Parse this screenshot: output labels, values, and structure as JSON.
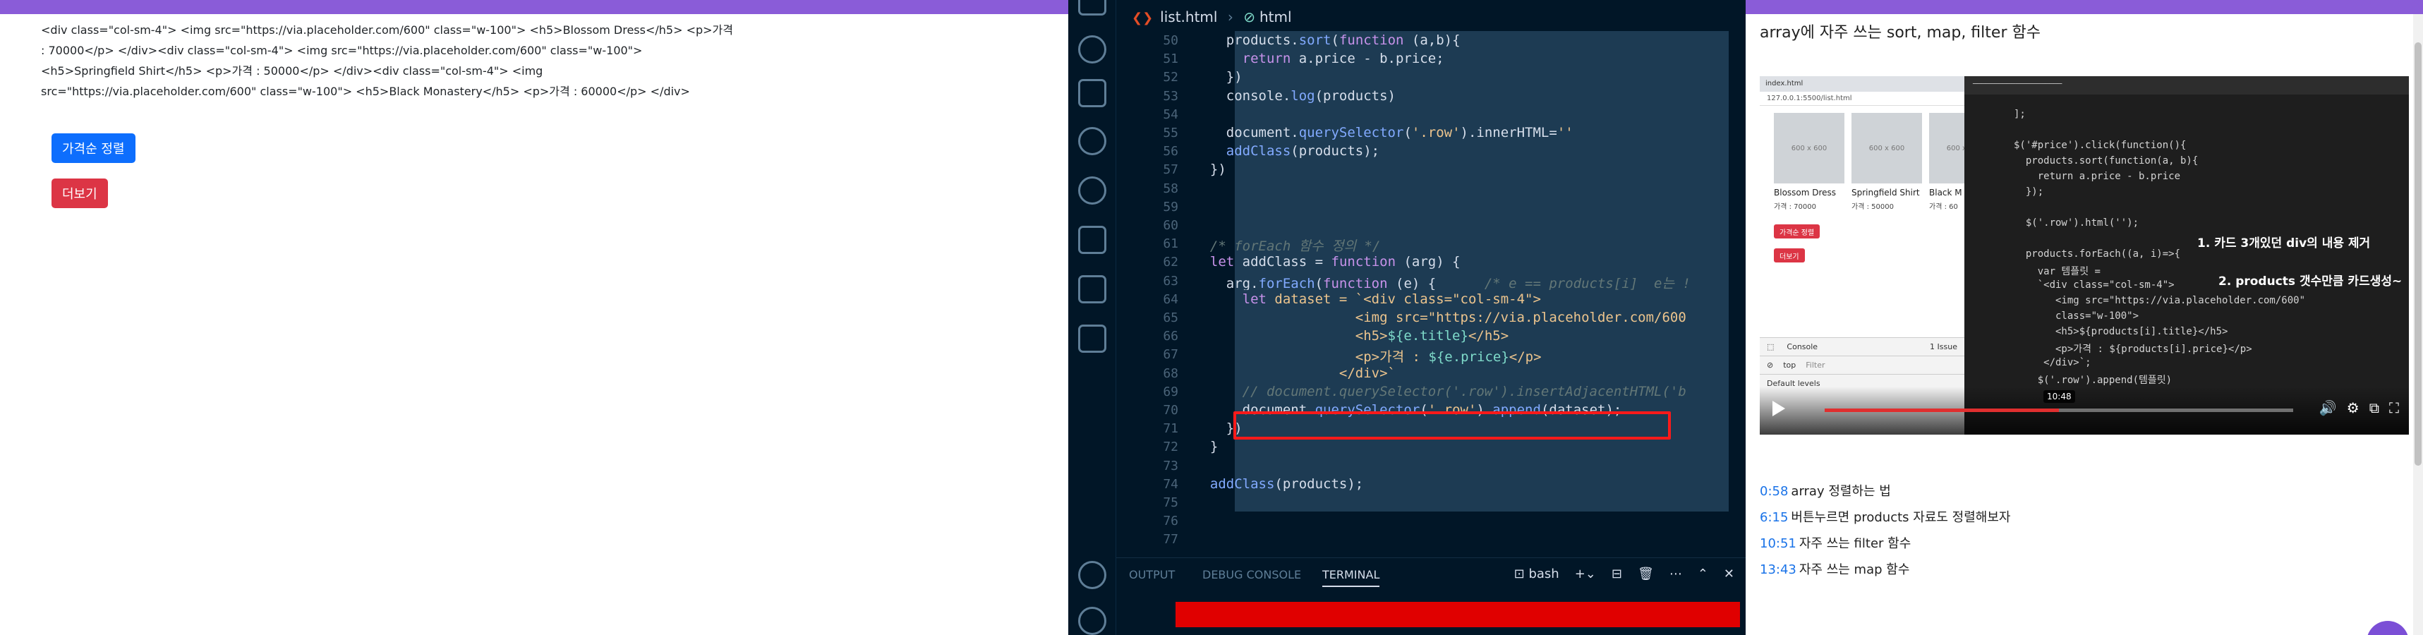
{
  "browser": {
    "raw_html_text": "<div class=\"col-sm-4\"> <img src=\"https://via.placeholder.com/600\" class=\"w-100\"> <h5>Blossom Dress</h5> <p>가격 : 70000</p> </div><div class=\"col-sm-4\"> <img src=\"https://via.placeholder.com/600\" class=\"w-100\"> <h5>Springfield Shirt</h5> <p>가격 : 50000</p> </div><div class=\"col-sm-4\"> <img src=\"https://via.placeholder.com/600\" class=\"w-100\"> <h5>Black Monastery</h5> <p>가격 : 60000</p> </div>",
    "sort_button": "가격순 정렬",
    "more_button": "더보기"
  },
  "editor": {
    "breadcrumb_file": "list.html",
    "breadcrumb_symbol": "html",
    "lines": [
      {
        "n": "50",
        "tokens": [
          [
            "    products.",
            ""
          ],
          [
            "sort",
            "f"
          ],
          [
            "(",
            ""
          ],
          [
            "function",
            "k"
          ],
          [
            " (a,b){",
            ""
          ]
        ]
      },
      {
        "n": "51",
        "tokens": [
          [
            "      ",
            ""
          ],
          [
            "return",
            "k"
          ],
          [
            " a.price - b.price;",
            ""
          ]
        ]
      },
      {
        "n": "52",
        "tokens": [
          [
            "    })",
            ""
          ]
        ]
      },
      {
        "n": "53",
        "tokens": [
          [
            "    console.",
            ""
          ],
          [
            "log",
            "f"
          ],
          [
            "(products)",
            ""
          ]
        ]
      },
      {
        "n": "54",
        "tokens": [
          [
            "",
            ""
          ]
        ]
      },
      {
        "n": "55",
        "tokens": [
          [
            "    document.",
            ""
          ],
          [
            "querySelector",
            "f"
          ],
          [
            "(",
            ""
          ],
          [
            "'.row'",
            "s"
          ],
          [
            ").innerHTML=",
            ""
          ],
          [
            "''",
            "s"
          ]
        ]
      },
      {
        "n": "56",
        "tokens": [
          [
            "    ",
            ""
          ],
          [
            "addClass",
            "f"
          ],
          [
            "(products);",
            ""
          ]
        ]
      },
      {
        "n": "57",
        "tokens": [
          [
            "  })",
            ""
          ]
        ]
      },
      {
        "n": "58",
        "tokens": [
          [
            "",
            ""
          ]
        ]
      },
      {
        "n": "59",
        "tokens": [
          [
            "",
            ""
          ]
        ]
      },
      {
        "n": "60",
        "tokens": [
          [
            "",
            ""
          ]
        ]
      },
      {
        "n": "61",
        "tokens": [
          [
            "  /* forEach 함수 정의 */",
            "c"
          ]
        ]
      },
      {
        "n": "62",
        "tokens": [
          [
            "  ",
            ""
          ],
          [
            "let",
            "k"
          ],
          [
            " addClass = ",
            ""
          ],
          [
            "function",
            "k"
          ],
          [
            " (arg) {",
            ""
          ]
        ]
      },
      {
        "n": "63",
        "tokens": [
          [
            "    arg.",
            ""
          ],
          [
            "forEach",
            "f"
          ],
          [
            "(",
            ""
          ],
          [
            "function",
            "k"
          ],
          [
            " (e) {      ",
            ""
          ],
          [
            "/* e == products[i]  e는 !",
            "c"
          ]
        ]
      },
      {
        "n": "64",
        "tokens": [
          [
            "      ",
            ""
          ],
          [
            "let",
            "k"
          ],
          [
            " dataset = `<div class=\"col-sm-4\">",
            "s"
          ]
        ]
      },
      {
        "n": "65",
        "tokens": [
          [
            "                    <img src=\"https://via.placeholder.com/600",
            "s"
          ]
        ]
      },
      {
        "n": "66",
        "tokens": [
          [
            "                    <h5>",
            "s"
          ],
          [
            "${e.title}",
            "p"
          ],
          [
            "</h5>",
            "s"
          ]
        ]
      },
      {
        "n": "67",
        "tokens": [
          [
            "                    <p>가격 : ",
            "s"
          ],
          [
            "${e.price}",
            "p"
          ],
          [
            "</p>",
            "s"
          ]
        ]
      },
      {
        "n": "68",
        "tokens": [
          [
            "                  </div>`",
            "s"
          ]
        ]
      },
      {
        "n": "69",
        "tokens": [
          [
            "      // document.querySelector('.row').insertAdjacentHTML('b",
            "c"
          ]
        ]
      },
      {
        "n": "70",
        "tokens": [
          [
            "      document.",
            ""
          ],
          [
            "querySelector",
            "f"
          ],
          [
            "(",
            ""
          ],
          [
            "'.row'",
            "s"
          ],
          [
            ").",
            ""
          ],
          [
            "append",
            "f"
          ],
          [
            "(dataset);",
            ""
          ]
        ]
      },
      {
        "n": "71",
        "tokens": [
          [
            "    })",
            ""
          ]
        ]
      },
      {
        "n": "72",
        "tokens": [
          [
            "  }",
            ""
          ]
        ]
      },
      {
        "n": "73",
        "tokens": [
          [
            "",
            ""
          ]
        ]
      },
      {
        "n": "74",
        "tokens": [
          [
            "  ",
            ""
          ],
          [
            "addClass",
            "f"
          ],
          [
            "(products);",
            ""
          ]
        ]
      },
      {
        "n": "75",
        "tokens": [
          [
            "",
            ""
          ]
        ]
      },
      {
        "n": "76",
        "tokens": [
          [
            "",
            ""
          ]
        ]
      },
      {
        "n": "77",
        "tokens": [
          [
            "",
            ""
          ]
        ]
      }
    ],
    "panel_tabs": [
      "OUTPUT",
      "DEBUG CONSOLE",
      "TERMINAL"
    ],
    "terminal_shell": "bash"
  },
  "video_page": {
    "title": "array에 자주 쓰는 sort, map, filter 함수",
    "mini_browser": {
      "tab": "index.html",
      "url": "127.0.0.1:5500/list.html",
      "cards": [
        {
          "img": "600 x 600",
          "title": "Blossom Dress",
          "price": "가격 : 70000"
        },
        {
          "img": "600 x 600",
          "title": "Springfield Shirt",
          "price": "가격 : 50000"
        },
        {
          "img": "600 x 600",
          "title": "Black M",
          "price": "가격 : 60"
        }
      ],
      "sort_btn": "가격순 정렬",
      "more_btn": "더보기",
      "devtools_tab": "Console",
      "devtools_top": "top",
      "devtools_filter": "Filter",
      "devtools_levels": "Default levels",
      "devtools_issue": "1 Issue"
    },
    "video_code": [
      "];",
      "",
      "$('#price').click(function(){",
      "  products.sort(function(a, b){",
      "    return a.price - b.price",
      "  });",
      "",
      "  $('.row').html('');",
      "",
      "  products.forEach((a, i)=>{",
      "    var 템플릿 =",
      "    `<div class=\"col-sm-4\">",
      "       <img src=\"https://via.placeholder.com/600\"",
      "       class=\"w-100\">",
      "       <h5>${products[i].title}</h5>",
      "       <p>가격 : ${products[i].price}</p>",
      "     </div>`;",
      "    $('.row').append(템플릿)"
    ],
    "annotation_1": "1. 카드 3개있던 div의 내용 제거",
    "annotation_2": "2. products 갯수만큼 카드생성~",
    "timestamp_tooltip": "10:48",
    "progress": 0.5,
    "chapters": [
      {
        "time": "0:58",
        "label": "array 정렬하는 법"
      },
      {
        "time": "6:15",
        "label": "버튼누르면 products 자료도 정렬해보자"
      },
      {
        "time": "10:51",
        "label": "자주 쓰는 filter 함수"
      },
      {
        "time": "13:43",
        "label": "자주 쓰는 map 함수"
      }
    ]
  }
}
